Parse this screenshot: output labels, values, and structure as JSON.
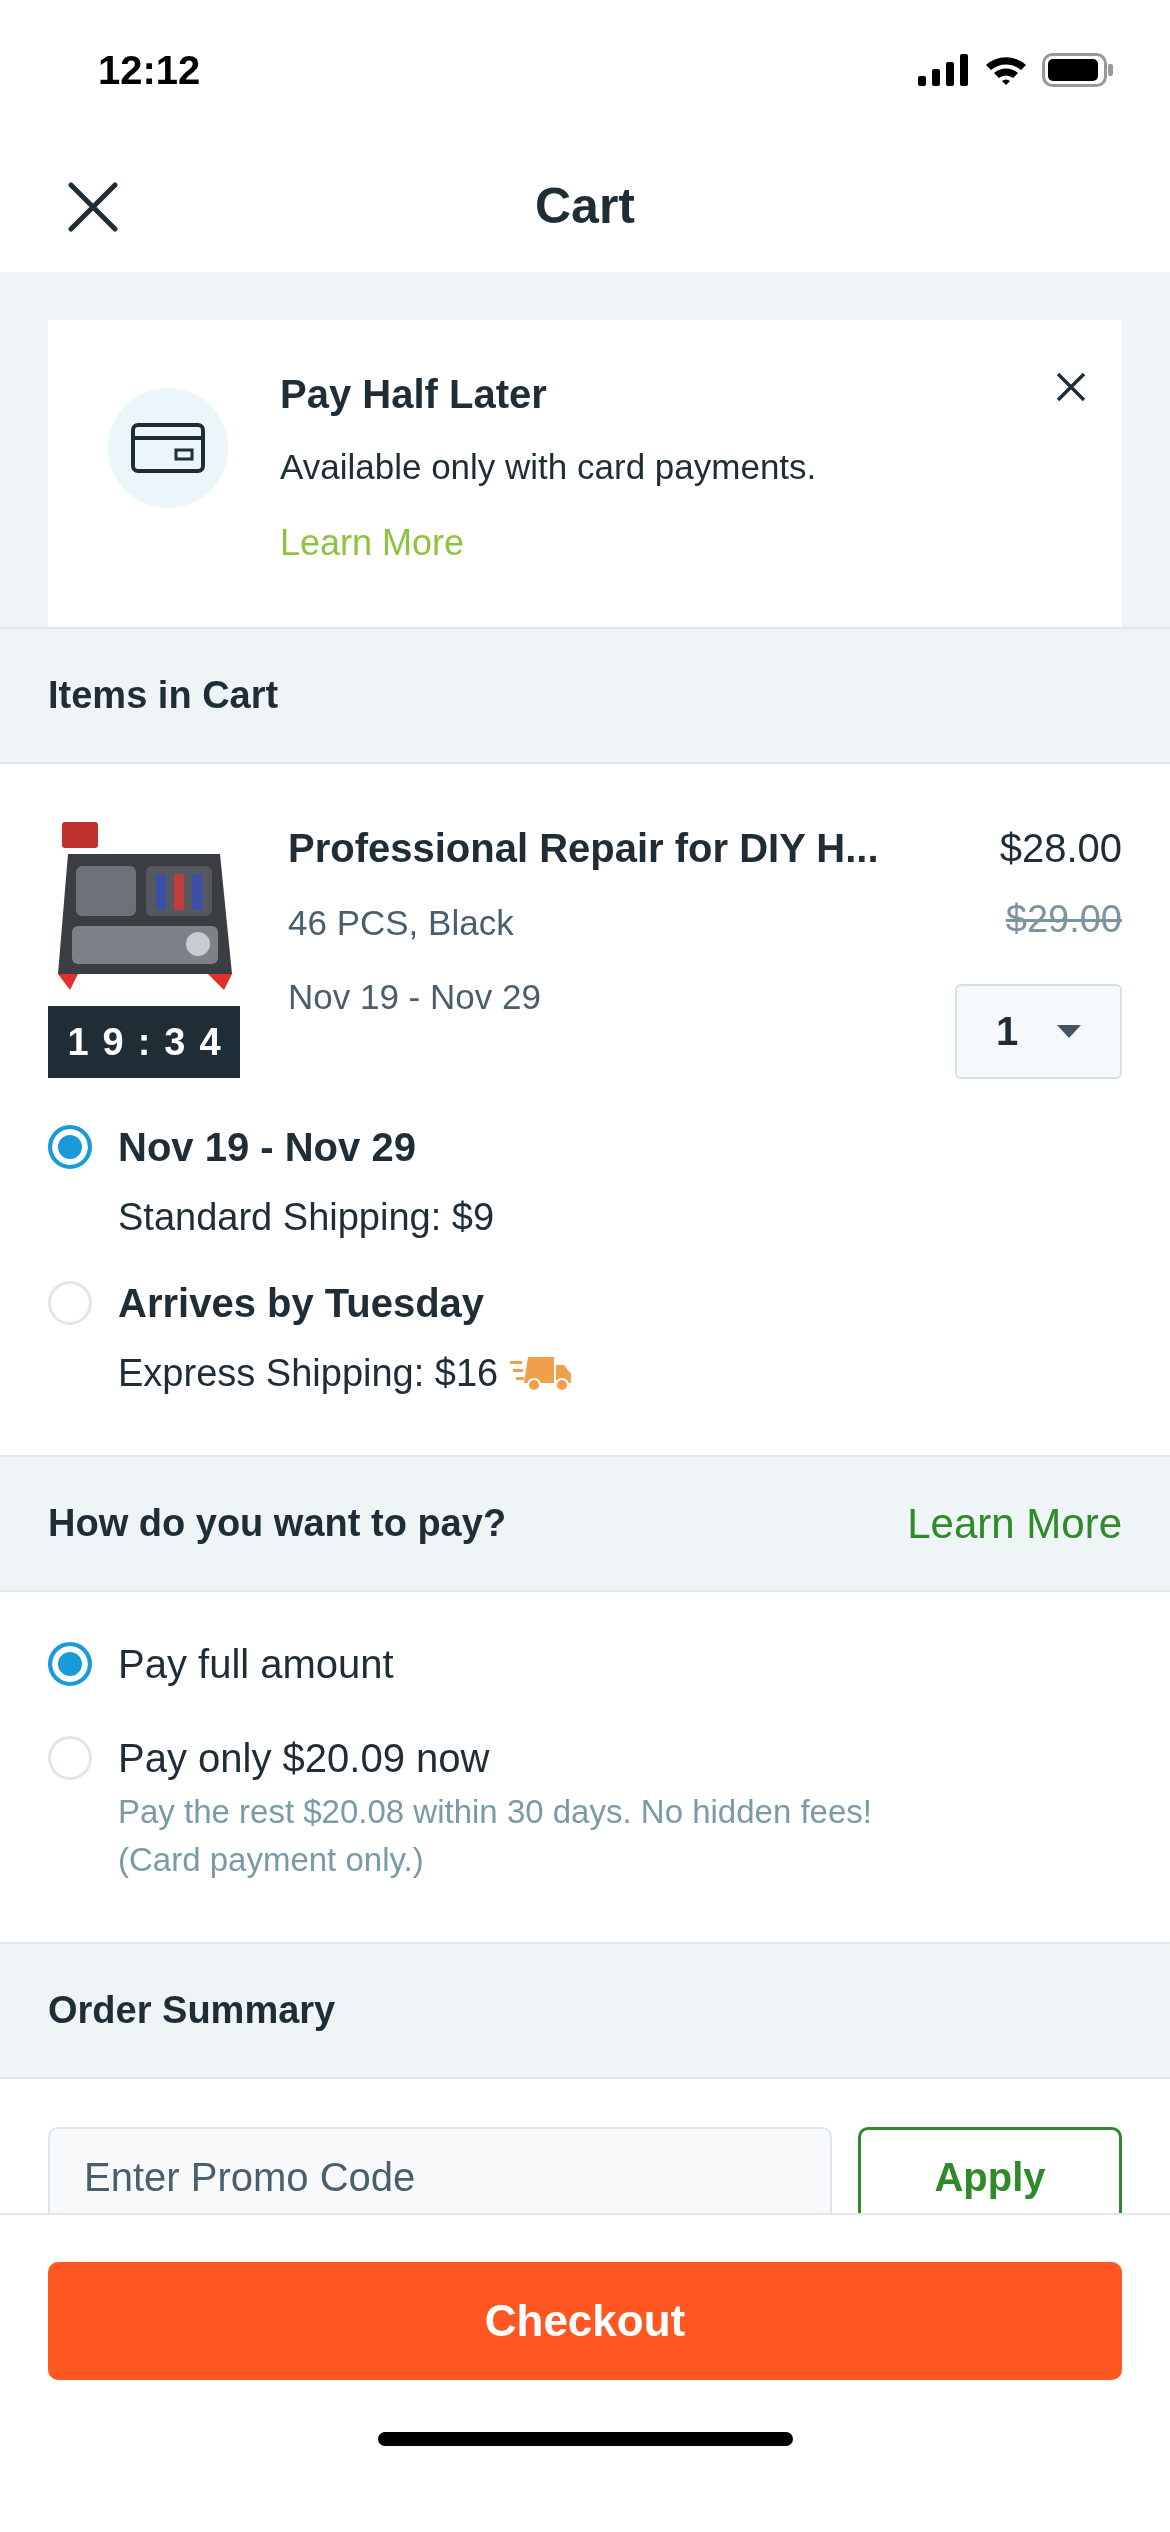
{
  "status_bar": {
    "time": "12:12"
  },
  "header": {
    "title": "Cart"
  },
  "promo_banner": {
    "title": "Pay Half Later",
    "text": "Available only with card payments.",
    "link": "Learn More"
  },
  "items_section": {
    "title": "Items in Cart"
  },
  "cart_items": [
    {
      "name": "Professional Repair for DIY H...",
      "variant": "46 PCS, Black",
      "dates": "Nov 19 - Nov 29",
      "price": "$28.00",
      "original_price": "$29.00",
      "timer": "19:34",
      "quantity": "1"
    }
  ],
  "shipping_options": [
    {
      "kind": "standard",
      "title": "Nov 19 - Nov 29",
      "detail": "Standard Shipping: $9",
      "selected": true
    },
    {
      "kind": "express",
      "title": "Arrives by Tuesday",
      "detail": "Express Shipping: $16",
      "selected": false
    }
  ],
  "payment_section": {
    "title": "How do you want to pay?",
    "link": "Learn More"
  },
  "payment_options": [
    {
      "label": "Pay full amount",
      "selected": true
    },
    {
      "label": "Pay only $20.09 now",
      "note_lines": [
        "Pay the rest $20.08 within 30 days. No hidden fees!",
        "(Card payment only.)"
      ],
      "selected": false
    }
  ],
  "summary": {
    "title": "Order Summary",
    "promo_placeholder": "Enter Promo Code",
    "apply": "Apply"
  },
  "checkout": "Checkout"
}
